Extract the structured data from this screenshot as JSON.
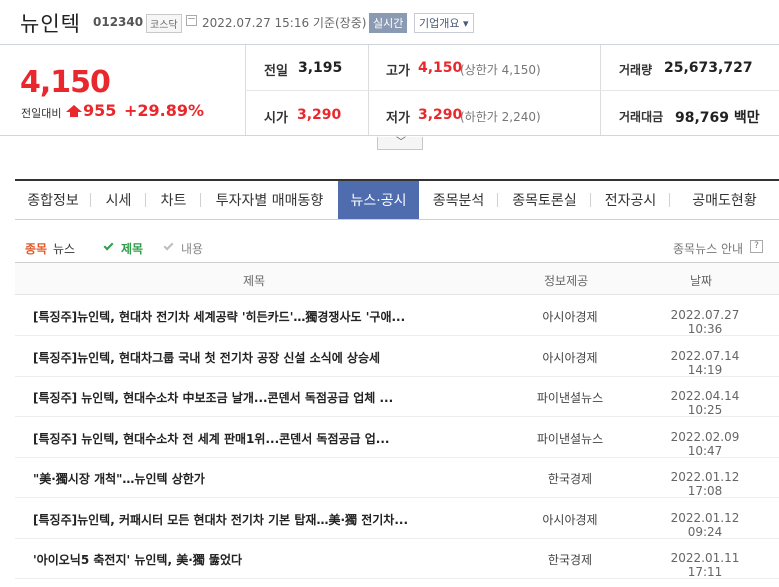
{
  "header": {
    "name": "뉴인텍",
    "code": "012340",
    "market": "코스닥",
    "time": "2022.07.27 15:16 기준(장중)",
    "realtime": "실시간",
    "company_btn": "기업개요 ▾"
  },
  "price": {
    "current": "4,150",
    "diff_label": "전일대비",
    "diff_value": "955",
    "pct": "+29.89%",
    "prev_label": "전일",
    "prev": "3,195",
    "open_label": "시가",
    "open": "3,290",
    "high_label": "고가",
    "high": "4,150",
    "upper_limit": "(상한가 4,150)",
    "low_label": "저가",
    "low": "3,290",
    "lower_limit": "(하한가 2,240)",
    "volume_label": "거래량",
    "volume": "25,673,727",
    "amount_label": "거래대금",
    "amount": "98,769 백만"
  },
  "tabs": [
    {
      "label": "종합정보",
      "width": 76
    },
    {
      "label": "시세",
      "width": 55
    },
    {
      "label": "차트",
      "width": 55
    },
    {
      "label": "투자자별 매매동향",
      "width": 137
    },
    {
      "label": "뉴스·공시",
      "width": 81,
      "active": true
    },
    {
      "label": "종목분석",
      "width": 79
    },
    {
      "label": "종목토론실",
      "width": 93
    },
    {
      "label": "전자공시",
      "width": 79
    },
    {
      "label": "공매도현황",
      "width": 109
    }
  ],
  "filter": {
    "news_a": "종목",
    "news_b": "뉴스",
    "title": "제목",
    "content": "내용",
    "info": "종목뉴스 안내",
    "q": "?"
  },
  "table": {
    "headers": [
      "제목",
      "정보제공",
      "날짜"
    ],
    "rows": [
      {
        "title": "[특징주]뉴인텍, 현대차 전기차 세계공략 '히든카드'…獨경쟁사도 '구애...",
        "src": "아시아경제",
        "date": "2022.07.27 10:36"
      },
      {
        "title": "[특징주]뉴인텍, 현대차그룹 국내 첫 전기차 공장 신설 소식에 상승세",
        "src": "아시아경제",
        "date": "2022.07.14 14:19"
      },
      {
        "title": "[특징주] 뉴인텍, 현대수소차 中보조금 날개...콘덴서 독점공급 업체 ...",
        "src": "파이낸셜뉴스",
        "date": "2022.04.14 10:25"
      },
      {
        "title": "[특징주] 뉴인텍, 현대수소차 전 세계 판매1위...콘덴서 독점공급 업...",
        "src": "파이낸셜뉴스",
        "date": "2022.02.09 10:47"
      },
      {
        "title": "\"美·獨시장 개척\"…뉴인텍 상한가",
        "src": "한국경제",
        "date": "2022.01.12 17:08"
      },
      {
        "title": "[특징주]뉴인텍, 커패시터 모든 현대차 전기차 기본 탑재…美·獨 전기차...",
        "src": "아시아경제",
        "date": "2022.01.12 09:24"
      },
      {
        "title": "'아이오닉5 축전지' 뉴인텍, 美·獨 뚫었다",
        "src": "한국경제",
        "date": "2022.01.11 17:11"
      }
    ]
  },
  "colors": {
    "up": "#e8282c",
    "tab_active": "#4e6cae",
    "check": "#2f9e4a"
  }
}
